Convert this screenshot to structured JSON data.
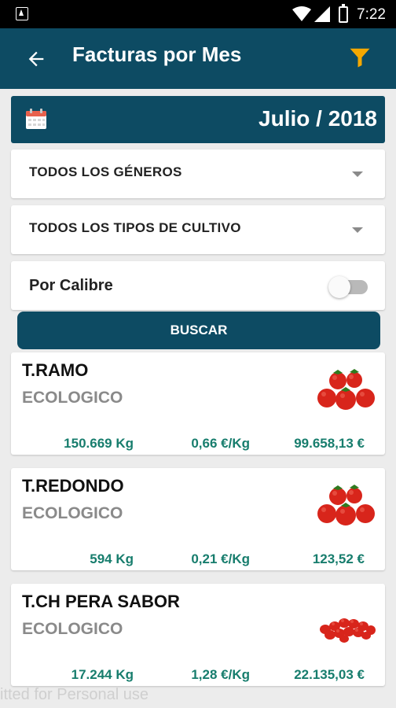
{
  "status_bar": {
    "time": "7:22",
    "icons": [
      "app-notification-icon",
      "wifi-icon",
      "signal-icon",
      "battery-icon"
    ]
  },
  "app_bar": {
    "title": "Facturas por Mes",
    "back_icon": "arrow-back-icon",
    "filter_icon": "filter-funnel-icon"
  },
  "date_selector": {
    "label": "Julio / 2018",
    "icon": "calendar-icon"
  },
  "filters": {
    "genero": "TODOS LOS GÉNEROS",
    "cultivo": "TODOS LOS TIPOS DE CULTIVO",
    "calibre_label": "Por Calibre",
    "calibre_on": false
  },
  "search_button": {
    "label": "BUSCAR"
  },
  "products": [
    {
      "name": "T.RAMO",
      "type": "ECOLOGICO",
      "kg": "150.669 Kg",
      "price": "0,66 €/Kg",
      "total": "99.658,13 €",
      "image": "tomato-cluster"
    },
    {
      "name": "T.REDONDO",
      "type": "ECOLOGICO",
      "kg": "594 Kg",
      "price": "0,21 €/Kg",
      "total": "123,52 €",
      "image": "tomato-cluster"
    },
    {
      "name": "T.CH PERA SABOR",
      "type": "ECOLOGICO",
      "kg": "17.244 Kg",
      "price": "1,28 €/Kg",
      "total": "22.135,03 €",
      "image": "cherry-tomato-pile"
    }
  ],
  "watermark": "itted for Personal use",
  "colors": {
    "primary": "#0d4b63",
    "accent": "#f5a800",
    "stat_text": "#177d6d",
    "background": "#ececec"
  }
}
